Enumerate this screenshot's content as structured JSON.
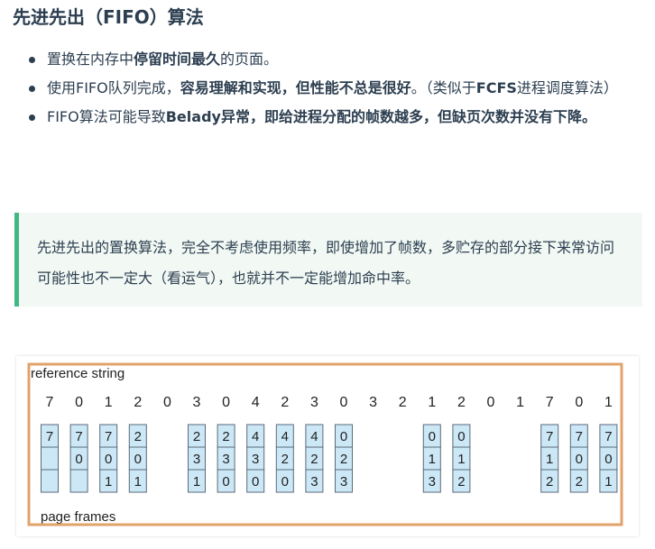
{
  "title": "先进先出（FIFO）算法",
  "bullets": [
    {
      "parts": [
        {
          "t": "置换在内存中",
          "b": false
        },
        {
          "t": "停留时间最久",
          "b": true
        },
        {
          "t": "的页面。",
          "b": false
        }
      ]
    },
    {
      "parts": [
        {
          "t": "使用FIFO队列完成，",
          "b": false
        },
        {
          "t": "容易理解和实现，但性能不总是很好",
          "b": true
        },
        {
          "t": "。（类似于",
          "b": false
        },
        {
          "t": "FCFS",
          "b": true
        },
        {
          "t": "进程调度算法）",
          "b": false
        }
      ]
    },
    {
      "parts": [
        {
          "t": "FIFO算法可能导致",
          "b": false
        },
        {
          "t": "Belady异常，即给进程分配的帧数越多，但缺页次数并没有下降。",
          "b": true
        }
      ]
    }
  ],
  "note": "先进先出的置换算法，完全不考虑使用频率，即使增加了帧数，多贮存的部分接下来常访问可能性也不一定大（看运气），也就并不一定能增加命中率。",
  "figure": {
    "reference_label": "reference string",
    "frames_label": "page frames",
    "reference_string": [
      "7",
      "0",
      "1",
      "2",
      "0",
      "3",
      "0",
      "4",
      "2",
      "3",
      "0",
      "3",
      "2",
      "1",
      "2",
      "0",
      "1",
      "7",
      "0",
      "1"
    ],
    "frames": [
      [
        "7",
        "",
        ""
      ],
      [
        "7",
        "0",
        ""
      ],
      [
        "7",
        "0",
        "1"
      ],
      [
        "2",
        "0",
        "1"
      ],
      null,
      [
        "2",
        "3",
        "1"
      ],
      [
        "2",
        "3",
        "0"
      ],
      [
        "4",
        "3",
        "0"
      ],
      [
        "4",
        "2",
        "0"
      ],
      [
        "4",
        "2",
        "3"
      ],
      [
        "0",
        "2",
        "3"
      ],
      null,
      null,
      [
        "0",
        "1",
        "3"
      ],
      [
        "0",
        "1",
        "2"
      ],
      null,
      null,
      [
        "7",
        "1",
        "2"
      ],
      [
        "7",
        "0",
        "2"
      ],
      [
        "7",
        "0",
        "1"
      ]
    ],
    "colors": {
      "cell_fill": "#cce8f7",
      "cell_stroke": "#5a6a78",
      "highlight": "#e0a36a",
      "text": "#222222"
    }
  }
}
